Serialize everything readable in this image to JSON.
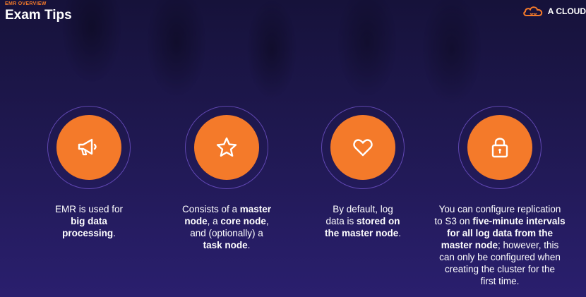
{
  "header": {
    "eyebrow": "EMR OVERVIEW",
    "title": "Exam Tips"
  },
  "logo": {
    "icon": "cloud-guru-logo-icon",
    "text": "A CLOUD"
  },
  "colors": {
    "accent": "#f47a2a",
    "background": "#1f1850",
    "ring": "#8a6cf0"
  },
  "tips": [
    {
      "icon": "megaphone-icon",
      "lines": [
        [
          {
            "t": "EMR is used for",
            "b": false
          }
        ],
        [
          {
            "t": "big data",
            "b": true
          }
        ],
        [
          {
            "t": "processing",
            "b": true
          },
          {
            "t": ".",
            "b": false
          }
        ]
      ]
    },
    {
      "icon": "star-icon",
      "lines": [
        [
          {
            "t": "Consists of a ",
            "b": false
          },
          {
            "t": "master",
            "b": true
          }
        ],
        [
          {
            "t": "node",
            "b": true
          },
          {
            "t": ", a ",
            "b": false
          },
          {
            "t": "core node",
            "b": true
          },
          {
            "t": ",",
            "b": false
          }
        ],
        [
          {
            "t": "and (optionally) a",
            "b": false
          }
        ],
        [
          {
            "t": "task node",
            "b": true
          },
          {
            "t": ".",
            "b": false
          }
        ]
      ]
    },
    {
      "icon": "heart-icon",
      "lines": [
        [
          {
            "t": "By default, log",
            "b": false
          }
        ],
        [
          {
            "t": "data is ",
            "b": false
          },
          {
            "t": "stored on",
            "b": true
          }
        ],
        [
          {
            "t": "the master node",
            "b": true
          },
          {
            "t": ".",
            "b": false
          }
        ]
      ]
    },
    {
      "icon": "lock-icon",
      "lines": [
        [
          {
            "t": "You can configure replication",
            "b": false
          }
        ],
        [
          {
            "t": "to S3 on ",
            "b": false
          },
          {
            "t": "five-minute intervals",
            "b": true
          }
        ],
        [
          {
            "t": "for all log data from the",
            "b": true
          }
        ],
        [
          {
            "t": "master node",
            "b": true
          },
          {
            "t": "; however, this",
            "b": false
          }
        ],
        [
          {
            "t": "can only be configured when",
            "b": false
          }
        ],
        [
          {
            "t": "creating the cluster for the",
            "b": false
          }
        ],
        [
          {
            "t": "first time.",
            "b": false
          }
        ]
      ]
    }
  ]
}
